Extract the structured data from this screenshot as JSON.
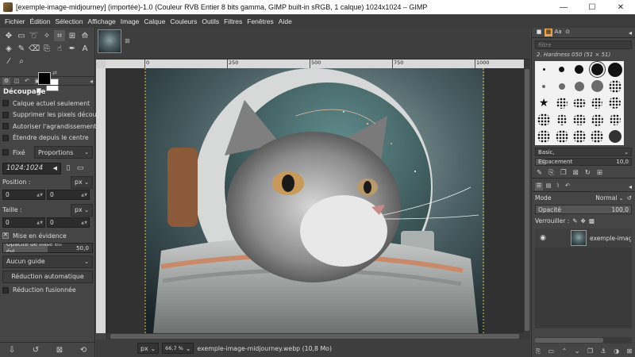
{
  "window": {
    "title": "[exemple-image-midjourney] (importée)-1.0 (Couleur RVB Entier 8 bits gamma, GIMP built-in sRGB, 1 calque) 1024x1024 – GIMP",
    "minimize": "—",
    "maximize": "☐",
    "close": "✕"
  },
  "menu": [
    "Fichier",
    "Édition",
    "Sélection",
    "Affichage",
    "Image",
    "Calque",
    "Couleurs",
    "Outils",
    "Filtres",
    "Fenêtres",
    "Aide"
  ],
  "tool_options": {
    "title": "Découpage",
    "current_layer_only": "Calque actuel seulement",
    "delete_cropped": "Supprimer les pixels découpés",
    "allow_growing": "Autoriser l'agrandissement",
    "expand_center": "Étendre depuis le centre",
    "fixed": "Fixé",
    "fixed_mode": "Proportions",
    "ratio": "1024:1024",
    "position_label": "Position :",
    "position_unit": "px",
    "position_x": "0",
    "position_y": "0",
    "size_label": "Taille :",
    "size_unit": "px",
    "size_w": "0",
    "size_h": "0",
    "highlight": "Mise en évidence",
    "highlight_opacity_label": "Opacité de mise en évi...",
    "highlight_opacity_value": "50,0",
    "highlight_opacity_fraction": 0.5,
    "guide": "Aucun guide",
    "auto_shrink": "Réduction automatique",
    "shrink_merged": "Réduction fusionnée"
  },
  "canvas": {
    "ruler_ticks": [
      "0",
      "250",
      "500",
      "750",
      "1000"
    ]
  },
  "status": {
    "unit": "px",
    "zoom": "66,7 %",
    "file": "exemple-image-midjourney.webp (10,8 Mo)"
  },
  "brushes": {
    "filter_placeholder": "filtre",
    "current": "2. Hardness 050 (51 × 51)",
    "preset": "Basic,",
    "spacing_label": "Espacement",
    "spacing_value": "10,0",
    "spacing_fraction": 0.1
  },
  "layers": {
    "mode_label": "Mode",
    "mode_value": "Normal",
    "opacity_label": "Opacité",
    "opacity_value": "100,0",
    "lock_label": "Verrouiller :",
    "layer_name": "exemple-image-m"
  },
  "colors": {
    "accent": "#e9a34a",
    "panel": "#454545"
  }
}
